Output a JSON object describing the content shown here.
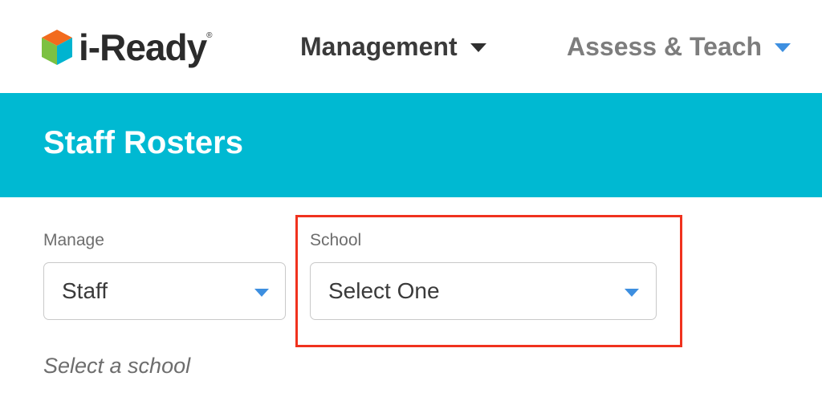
{
  "header": {
    "logo_text": "i-Ready",
    "logo_mark": "®",
    "nav": [
      {
        "label": "Management",
        "icon": "caret-down-icon",
        "color": "#3a3a3a"
      },
      {
        "label": "Assess & Teach",
        "icon": "caret-down-icon",
        "color": "#7d7d7d"
      }
    ]
  },
  "banner": {
    "title": "Staff Rosters",
    "background": "#00b9d2"
  },
  "form": {
    "manage": {
      "label": "Manage",
      "value": "Staff"
    },
    "school": {
      "label": "School",
      "value": "Select One"
    },
    "hint": "Select a school"
  },
  "colors": {
    "accent": "#3d8fe0",
    "highlight": "#f0321e"
  }
}
